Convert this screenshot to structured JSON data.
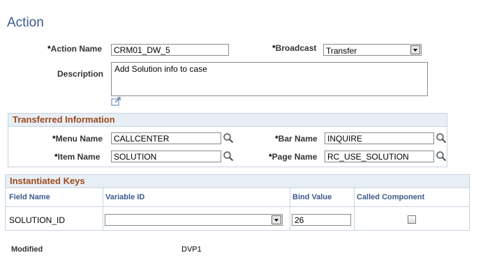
{
  "page": {
    "title": "Action"
  },
  "action": {
    "action_name_label": "Action Name",
    "action_name_value": "CRM01_DW_5",
    "broadcast_label": "Broadcast",
    "broadcast_value": "Transfer",
    "description_label": "Description",
    "description_value": "Add Solution info to case",
    "required_mark": "*"
  },
  "transferred": {
    "title": "Transferred Information",
    "menu_name_label": "Menu Name",
    "menu_name_value": "CALLCENTER",
    "bar_name_label": "Bar Name",
    "bar_name_value": "INQUIRE",
    "item_name_label": "Item Name",
    "item_name_value": "SOLUTION",
    "page_name_label": "Page Name",
    "page_name_value": "RC_USE_SOLUTION"
  },
  "keys": {
    "title": "Instantiated Keys",
    "columns": [
      "Field Name",
      "Variable ID",
      "Bind Value",
      "Called Component"
    ],
    "rows": [
      {
        "field_name": "SOLUTION_ID",
        "variable_id": "",
        "bind_value": "26",
        "called_component": false
      }
    ]
  },
  "footer": {
    "modified_label": "Modified",
    "modified_value": "DVP1"
  },
  "icons": {
    "lookup": "magnifier-icon",
    "expand": "expand-text-icon"
  },
  "colors": {
    "title": "#3c5a8a",
    "section_title": "#9c4a1a",
    "section_header_bg": "#e8eef5"
  }
}
